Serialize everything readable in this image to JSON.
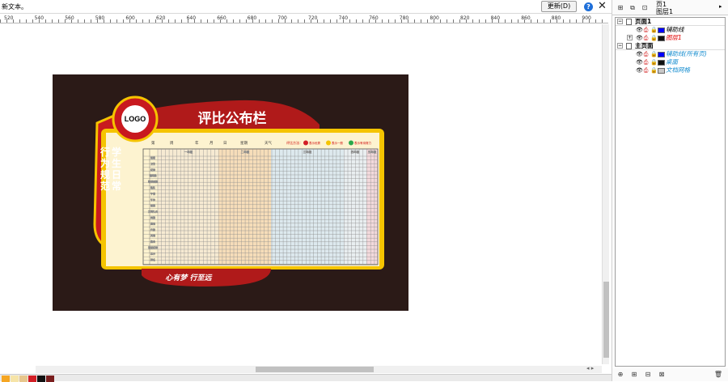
{
  "status": {
    "message": "新文本。",
    "update_button": "更新(D)"
  },
  "ruler_labels": [
    "520",
    "540",
    "560",
    "580",
    "600",
    "620",
    "640",
    "660",
    "680",
    "700",
    "720",
    "740",
    "760",
    "780",
    "800",
    "820",
    "840",
    "860",
    "880",
    "900"
  ],
  "board": {
    "logo": "LOGO",
    "title": "评比公布栏",
    "side_lines": [
      "学生日常",
      "行为规范"
    ],
    "slogan": "心有梦 行至远",
    "header_fields": [
      "第",
      "周",
      "年",
      "月",
      "日",
      "星期",
      "天气"
    ],
    "legend_label": "评比方法：",
    "legend_items": [
      "表示优秀",
      "表示一般",
      "表示有待努力"
    ],
    "grade_headers": [
      "一年级",
      "二年级",
      "三年级",
      "四年级",
      "五年级"
    ],
    "row_labels": [
      "班级",
      "卫生",
      "纪律",
      "课间操",
      "眼保健操",
      "路队",
      "午餐",
      "午休",
      "着装",
      "文明礼仪",
      "两操",
      "晨读",
      "升旗",
      "其他",
      "集会",
      "课堂纪律",
      "总分",
      "排名"
    ]
  },
  "panel": {
    "page_label": "页1",
    "layer_label": "图层1",
    "tree": [
      {
        "type": "page",
        "label": "页面1"
      },
      {
        "type": "layer",
        "label": "辅助线",
        "color": "#0000ff",
        "name_color": "#000000"
      },
      {
        "type": "layer",
        "label": "图层1",
        "color": "#111111",
        "name_color": "#e00000"
      },
      {
        "type": "page",
        "label": "主页面"
      },
      {
        "type": "layer",
        "label": "辅助线(所有页)",
        "color": "#0000ff",
        "name_color": "#1a8fd0"
      },
      {
        "type": "layer",
        "label": "桌面",
        "color": "#111111",
        "name_color": "#1a8fd0"
      },
      {
        "type": "layer",
        "label": "文档网格",
        "color": "#c8c8c8",
        "name_color": "#1a8fd0"
      }
    ]
  },
  "colors": {
    "board_bg": "#2b1a17",
    "red": "#b01a1a",
    "yellow": "#f5c400",
    "palette": [
      "#f5a623",
      "#f6e4a8",
      "#e7c68c",
      "#d21f26",
      "#111111",
      "#7a1e1e"
    ]
  }
}
